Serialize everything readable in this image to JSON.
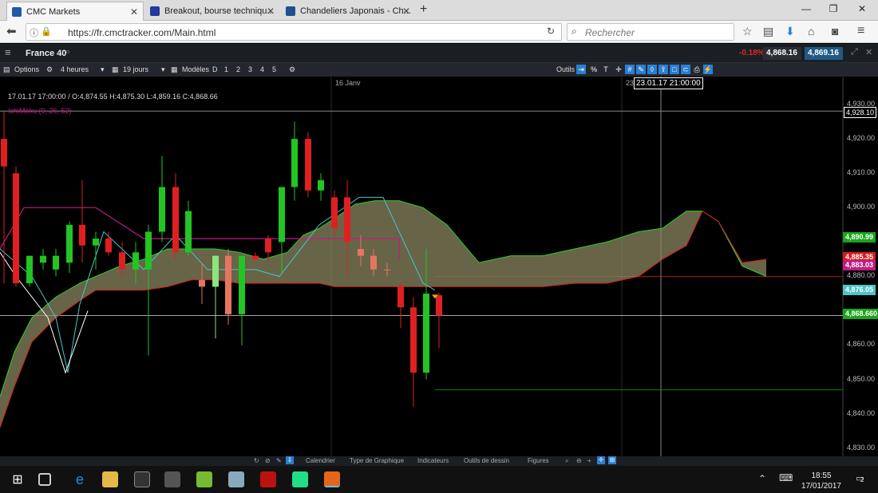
{
  "browser": {
    "tabs": [
      {
        "label": "CMC Markets",
        "icon": "cmc-icon",
        "color": "#1f5aa6"
      },
      {
        "label": "Breakout, bourse techniqu...",
        "icon": "breakout-icon",
        "color": "#213a9c"
      },
      {
        "label": "Chandeliers Japonais - Ch...",
        "icon": "chandeliers-icon",
        "color": "#1f4f8c"
      }
    ],
    "url": "https://fr.cmctracker.com/Main.html",
    "search_placeholder": "Rechercher"
  },
  "app": {
    "instrument": "France 40",
    "change": "-0.18%",
    "bid": "4,868.16",
    "ask": "4,869.16",
    "options_label": "Options",
    "interval": "4 heures",
    "range": "19 jours",
    "models_label": "Modèles",
    "layout_buttons": [
      "D",
      "1",
      "2",
      "3",
      "4",
      "5"
    ],
    "tools_label": "Outils",
    "percent_label": "%",
    "text_tool_label": "T",
    "accent": "#2a7fd4"
  },
  "chart": {
    "info_text": "17.01.17 17:00:00 / O:4,874.55  H:4,875.30  L:4,859.16  C:4,868.66",
    "indicator_label": "IchiMoku (9, 26, 52)",
    "date_label": "16 Janv",
    "date_label2": "23",
    "crosshair_time": "23.01.17 21:00:00",
    "crosshair_price": "4,928.10",
    "price_ticks": [
      "4,930.00",
      "4,920.00",
      "4,910.00",
      "4,900.00",
      "4,880.00",
      "4,860.00",
      "4,850.00",
      "4,840.00",
      "4,830.00"
    ],
    "price_tags": [
      {
        "label": "4,890.99",
        "color": "#1aa51a"
      },
      {
        "label": "4,885.35",
        "color": "#d81b1b"
      },
      {
        "label": "4,883.03",
        "color": "#c01c82"
      },
      {
        "label": "4,876.05",
        "color": "#4ac5c8"
      },
      {
        "label": "4,868.660",
        "color": "#1aa51a"
      }
    ]
  },
  "chart_data": {
    "type": "candlestick",
    "title": "France 40",
    "interval": "4 heures",
    "ylim": [
      4830,
      4930
    ],
    "candles": [
      {
        "o": 4920,
        "h": 4928,
        "l": 4878,
        "c": 4912,
        "dir": "down"
      },
      {
        "o": 4910,
        "h": 4912,
        "l": 4877,
        "c": 4878,
        "dir": "down"
      },
      {
        "o": 4878,
        "h": 4886,
        "l": 4877,
        "c": 4886,
        "dir": "up"
      },
      {
        "o": 4884,
        "h": 4888,
        "l": 4882,
        "c": 4886,
        "dir": "up"
      },
      {
        "o": 4882,
        "h": 4888,
        "l": 4880,
        "c": 4886,
        "dir": "up"
      },
      {
        "o": 4884,
        "h": 4896,
        "l": 4881,
        "c": 4895,
        "dir": "up"
      },
      {
        "o": 4895,
        "h": 4908,
        "l": 4884,
        "c": 4889,
        "dir": "down"
      },
      {
        "o": 4889,
        "h": 4893,
        "l": 4882,
        "c": 4891,
        "dir": "up"
      },
      {
        "o": 4891,
        "h": 4893,
        "l": 4886,
        "c": 4887,
        "dir": "down"
      },
      {
        "o": 4887,
        "h": 4890,
        "l": 4880,
        "c": 4882,
        "dir": "down"
      },
      {
        "o": 4882,
        "h": 4890,
        "l": 4878,
        "c": 4887,
        "dir": "up"
      },
      {
        "o": 4882,
        "h": 4895,
        "l": 4857,
        "c": 4893,
        "dir": "up"
      },
      {
        "o": 4893,
        "h": 4915,
        "l": 4890,
        "c": 4906,
        "dir": "up"
      },
      {
        "o": 4906,
        "h": 4910,
        "l": 4885,
        "c": 4887,
        "dir": "down"
      },
      {
        "o": 4887,
        "h": 4902,
        "l": 4886,
        "c": 4899,
        "dir": "up"
      },
      {
        "o": 4879,
        "h": 4884,
        "l": 4872,
        "c": 4877,
        "dir": "down"
      },
      {
        "o": 4877,
        "h": 4886,
        "l": 4862,
        "c": 4886,
        "dir": "up"
      },
      {
        "o": 4886,
        "h": 4888,
        "l": 4866,
        "c": 4869,
        "dir": "down"
      },
      {
        "o": 4869,
        "h": 4886,
        "l": 4860,
        "c": 4886,
        "dir": "up"
      },
      {
        "o": 4886,
        "h": 4887,
        "l": 4884,
        "c": 4885,
        "dir": "up"
      },
      {
        "o": 4887,
        "h": 4892,
        "l": 4884,
        "c": 4891,
        "dir": "down"
      },
      {
        "o": 4890,
        "h": 4904,
        "l": 4881,
        "c": 4906,
        "dir": "up"
      },
      {
        "o": 4906,
        "h": 4925,
        "l": 4902,
        "c": 4920,
        "dir": "up"
      },
      {
        "o": 4920,
        "h": 4922,
        "l": 4903,
        "c": 4905,
        "dir": "down"
      },
      {
        "o": 4905,
        "h": 4910,
        "l": 4902,
        "c": 4908,
        "dir": "up"
      },
      {
        "o": 4903,
        "h": 4905,
        "l": 4892,
        "c": 4894,
        "dir": "down"
      },
      {
        "o": 4903,
        "h": 4908,
        "l": 4880,
        "c": 4890,
        "dir": "down"
      },
      {
        "o": 4888,
        "h": 4892,
        "l": 4883,
        "c": 4886,
        "dir": "down"
      },
      {
        "o": 4886,
        "h": 4888,
        "l": 4880,
        "c": 4882,
        "dir": "down"
      },
      {
        "o": 4882,
        "h": 4884,
        "l": 4880,
        "c": 4882,
        "dir": "down"
      },
      {
        "o": 4877,
        "h": 4878,
        "l": 4865,
        "c": 4871,
        "dir": "down"
      },
      {
        "o": 4871,
        "h": 4874,
        "l": 4842,
        "c": 4852,
        "dir": "down"
      },
      {
        "o": 4852,
        "h": 4888,
        "l": 4850,
        "c": 4875,
        "dir": "up"
      },
      {
        "o": 4874.55,
        "h": 4875.3,
        "l": 4859.16,
        "c": 4868.66,
        "dir": "down"
      }
    ]
  },
  "bottom_tools": [
    "Calendrier",
    "Type de Graphique",
    "Indicateurs",
    "Outils de dessin",
    "Figures"
  ],
  "taskbar": {
    "time": "18:55",
    "date": "17/01/2017",
    "notifications": "2"
  }
}
